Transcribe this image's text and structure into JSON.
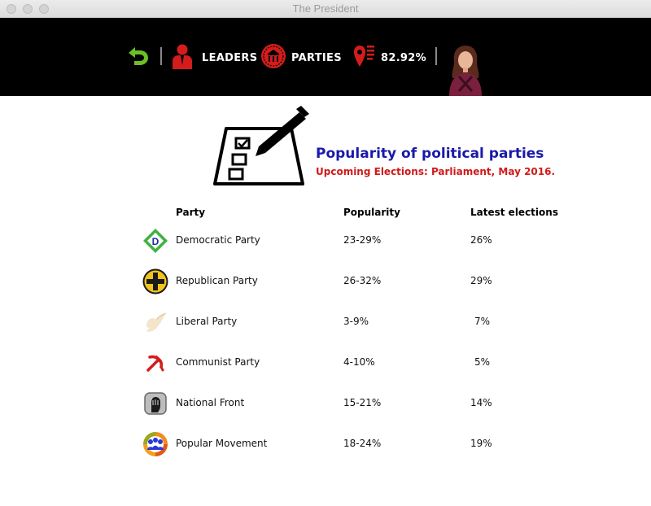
{
  "window": {
    "title": "The President"
  },
  "topbar": {
    "back_icon": "back-arrow-icon",
    "leaders_label": "LEADERS",
    "parties_label": "PARTIES",
    "approval_value": "82.92%"
  },
  "heading": {
    "title": "Popularity of political parties",
    "subtitle": "Upcoming Elections: Parliament, May 2016."
  },
  "table": {
    "headers": {
      "party": "Party",
      "popularity": "Popularity",
      "latest": "Latest elections"
    },
    "rows": [
      {
        "name": "Democratic Party",
        "popularity": "23-29%",
        "latest": "26%",
        "icon": "democratic-party-icon"
      },
      {
        "name": "Republican Party",
        "popularity": "26-32%",
        "latest": "29%",
        "icon": "republican-party-icon"
      },
      {
        "name": "Liberal Party",
        "popularity": "3-9%",
        "latest": "7%",
        "icon": "liberal-party-icon"
      },
      {
        "name": "Communist Party",
        "popularity": "4-10%",
        "latest": "5%",
        "icon": "communist-party-icon"
      },
      {
        "name": "National Front",
        "popularity": "15-21%",
        "latest": "14%",
        "icon": "national-front-icon"
      },
      {
        "name": "Popular Movement",
        "popularity": "18-24%",
        "latest": "19%",
        "icon": "popular-movement-icon"
      }
    ]
  },
  "colors": {
    "title_blue": "#1a1aa8",
    "subtitle_red": "#d01a1a",
    "accent_red": "#d41c1c",
    "back_green": "#6cc024"
  }
}
